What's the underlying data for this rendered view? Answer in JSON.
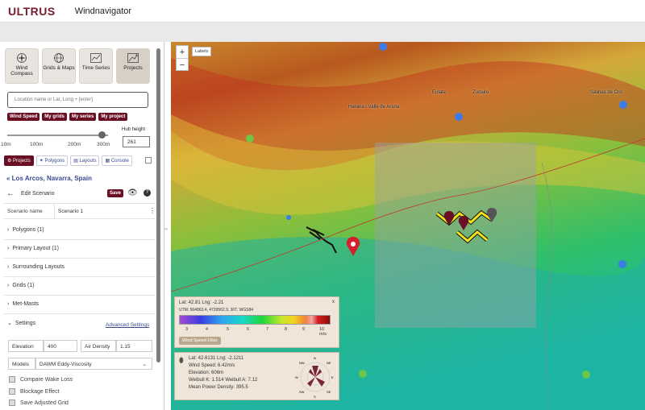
{
  "header": {
    "logo": "ULTRUS",
    "title": "Windnavigator"
  },
  "tools": [
    {
      "label": "Wind Compass",
      "icon": "compass-icon"
    },
    {
      "label": "Grids & Maps",
      "icon": "globe-icon"
    },
    {
      "label": "Time Series",
      "icon": "chart-icon"
    },
    {
      "label": "Projects",
      "icon": "projects-icon"
    }
  ],
  "search": {
    "placeholder": "Location name or Lat, Long + [enter]"
  },
  "chips": [
    "Wind Speed",
    "My grids",
    "My series",
    "My project"
  ],
  "hub": {
    "label": "Hub height",
    "value": "261",
    "ticks": [
      "10m",
      "100m",
      "200m",
      "300m"
    ],
    "level_fraction": 0.87
  },
  "tabs": [
    "Projects",
    "Polygons",
    "Layouts",
    "Console"
  ],
  "breadcrumb": "« Los Arcos, Navarra, Spain",
  "edit": {
    "title": "Edit Scenario",
    "save": "Save"
  },
  "scenario": {
    "key": "Scenario name",
    "value": "Scenario 1"
  },
  "sections": [
    "Polygons (1)",
    "Primary Layout (1)",
    "Surrounding Layouts",
    "Grids (1)",
    "Met-Masts",
    "Settings"
  ],
  "advanced": "Advanced Settings",
  "settings": {
    "elevation_label": "Elevation",
    "elevation_value": "400",
    "air_density_label": "Air Density",
    "air_density_value": "1.15",
    "models_label": "Models",
    "models_value": "DAWM Eddy-Viscosity"
  },
  "checkboxes": [
    "Compare Wake Loss",
    "Blockage Effect",
    "Save Adjusted Grid"
  ],
  "map": {
    "zoom_in": "+",
    "zoom_out": "−",
    "labels_button": "Labels",
    "places": [
      {
        "name": "Valle de Arana",
        "pair": "Harana / Valle de Arana"
      },
      {
        "name": "Zudaire"
      },
      {
        "name": "Salinas de Oro"
      },
      {
        "name": "Eulate"
      }
    ]
  },
  "wind_info": {
    "coords": "Lat: 42.81 Lng: -2.21",
    "utm": "UTM: 564863.4, 4739562.9, 30T, WGS84",
    "ticks": [
      "3",
      "4",
      "5",
      "6",
      "7",
      "8",
      "9",
      "10 m/s"
    ],
    "filter_button": "Wind Speed Filter",
    "close": "x"
  },
  "point_info": {
    "coords": "Lat: 42.6131 Lng: -2.1211",
    "wind_speed": "Wind Speed: 6.42m/s",
    "elevation": "Elevation: 606m",
    "weibull": "Weibull K: 1.514 Weibull A: 7.12",
    "power_density": "Mean Power Density: 395.5",
    "rose_labels": [
      "N",
      "NE",
      "E",
      "SE",
      "S",
      "SW",
      "W",
      "NW"
    ]
  },
  "colors": {
    "brand": "#6a0f23",
    "link": "#3a4a8f"
  }
}
